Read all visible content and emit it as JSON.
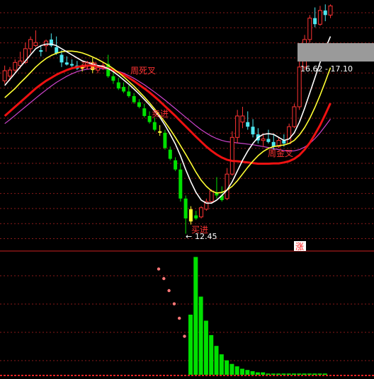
{
  "chart_data": {
    "type": "candlestick",
    "price_panel": {
      "annotations": {
        "buy_1": "买进",
        "weekly_death_cross": "周死叉",
        "sell": "卖进",
        "weekly_golden_cross": "周金叉",
        "buy_2": "买进",
        "low_price": "12.45",
        "range_label": "16.62 - 17.10",
        "rise_tag": "涨"
      },
      "candles": [
        {
          "o": 17.78,
          "h": 17.95,
          "l": 17.35,
          "c": 17.45,
          "color": "red"
        },
        {
          "o": 17.6,
          "h": 17.9,
          "l": 17.45,
          "c": 17.8,
          "color": "red"
        },
        {
          "o": 17.8,
          "h": 18.15,
          "l": 17.7,
          "c": 18.05,
          "color": "red"
        },
        {
          "o": 18.1,
          "h": 18.4,
          "l": 17.85,
          "c": 17.95,
          "color": "red"
        },
        {
          "o": 18.05,
          "h": 18.7,
          "l": 18.0,
          "c": 18.5,
          "color": "red"
        },
        {
          "o": 18.5,
          "h": 18.9,
          "l": 18.35,
          "c": 18.8,
          "color": "red"
        },
        {
          "o": 18.6,
          "h": 19.1,
          "l": 18.55,
          "c": 18.7,
          "color": "red"
        },
        {
          "o": 18.4,
          "h": 18.6,
          "l": 18.25,
          "c": 18.45,
          "color": "cyan"
        },
        {
          "o": 18.6,
          "h": 18.8,
          "l": 18.4,
          "c": 18.75,
          "color": "red"
        },
        {
          "o": 18.8,
          "h": 19.0,
          "l": 18.55,
          "c": 18.6,
          "color": "cyan"
        },
        {
          "o": 18.55,
          "h": 18.9,
          "l": 18.3,
          "c": 18.35,
          "color": "cyan"
        },
        {
          "o": 18.3,
          "h": 18.45,
          "l": 17.9,
          "c": 18.05,
          "color": "cyan"
        },
        {
          "o": 18.05,
          "h": 18.25,
          "l": 17.95,
          "c": 17.98,
          "color": "cyan"
        },
        {
          "o": 18.0,
          "h": 18.15,
          "l": 17.9,
          "c": 17.95,
          "color": "cyan"
        },
        {
          "o": 17.95,
          "h": 18.1,
          "l": 17.8,
          "c": 17.85,
          "color": "cyan"
        },
        {
          "o": 17.85,
          "h": 18.0,
          "l": 17.75,
          "c": 17.9,
          "color": "yellow"
        },
        {
          "o": 17.95,
          "h": 18.1,
          "l": 17.85,
          "c": 18.05,
          "color": "red"
        },
        {
          "o": 18.05,
          "h": 18.2,
          "l": 17.7,
          "c": 17.8,
          "color": "yellow"
        },
        {
          "o": 17.8,
          "h": 17.95,
          "l": 17.7,
          "c": 17.88,
          "color": "red"
        },
        {
          "o": 17.9,
          "h": 18.05,
          "l": 17.8,
          "c": 17.95,
          "color": "red"
        },
        {
          "o": 18.0,
          "h": 18.3,
          "l": 17.55,
          "c": 17.6,
          "color": "green"
        },
        {
          "o": 17.6,
          "h": 17.8,
          "l": 17.35,
          "c": 17.45,
          "color": "green"
        },
        {
          "o": 17.4,
          "h": 17.55,
          "l": 17.15,
          "c": 17.2,
          "color": "green"
        },
        {
          "o": 17.25,
          "h": 17.4,
          "l": 17.05,
          "c": 17.1,
          "color": "green"
        },
        {
          "o": 17.1,
          "h": 17.3,
          "l": 16.9,
          "c": 16.95,
          "color": "green"
        },
        {
          "o": 16.95,
          "h": 17.05,
          "l": 16.7,
          "c": 16.75,
          "color": "green"
        },
        {
          "o": 16.75,
          "h": 16.85,
          "l": 16.55,
          "c": 16.6,
          "color": "green"
        },
        {
          "o": 16.55,
          "h": 16.7,
          "l": 16.25,
          "c": 16.3,
          "color": "green"
        },
        {
          "o": 16.3,
          "h": 16.45,
          "l": 16.05,
          "c": 16.1,
          "color": "green"
        },
        {
          "o": 16.1,
          "h": 16.25,
          "l": 15.8,
          "c": 15.85,
          "color": "green"
        },
        {
          "o": 15.8,
          "h": 16.0,
          "l": 15.65,
          "c": 15.75,
          "color": "yellow"
        },
        {
          "o": 15.75,
          "h": 15.85,
          "l": 15.2,
          "c": 15.25,
          "color": "green"
        },
        {
          "o": 15.2,
          "h": 15.3,
          "l": 14.85,
          "c": 14.9,
          "color": "green"
        },
        {
          "o": 14.85,
          "h": 14.95,
          "l": 14.5,
          "c": 14.55,
          "color": "green"
        },
        {
          "o": 14.55,
          "h": 14.75,
          "l": 13.5,
          "c": 13.6,
          "color": "green"
        },
        {
          "o": 13.6,
          "h": 13.7,
          "l": 12.45,
          "c": 12.95,
          "color": "green"
        },
        {
          "o": 12.85,
          "h": 13.35,
          "l": 12.75,
          "c": 13.25,
          "color": "yellow"
        },
        {
          "o": 13.05,
          "h": 13.2,
          "l": 12.9,
          "c": 12.95,
          "color": "green"
        },
        {
          "o": 13.0,
          "h": 13.35,
          "l": 12.95,
          "c": 13.3,
          "color": "red"
        },
        {
          "o": 13.25,
          "h": 13.6,
          "l": 13.2,
          "c": 13.5,
          "color": "red"
        },
        {
          "o": 13.5,
          "h": 13.9,
          "l": 13.45,
          "c": 13.85,
          "color": "red"
        },
        {
          "o": 13.8,
          "h": 14.3,
          "l": 13.6,
          "c": 13.7,
          "color": "green"
        },
        {
          "o": 13.7,
          "h": 14.0,
          "l": 13.5,
          "c": 13.55,
          "color": "green"
        },
        {
          "o": 13.6,
          "h": 14.6,
          "l": 13.55,
          "c": 14.4,
          "color": "red"
        },
        {
          "o": 14.4,
          "h": 15.8,
          "l": 14.35,
          "c": 15.6,
          "color": "red"
        },
        {
          "o": 15.6,
          "h": 16.5,
          "l": 15.4,
          "c": 16.3,
          "color": "red"
        },
        {
          "o": 16.3,
          "h": 16.6,
          "l": 15.9,
          "c": 16.1,
          "color": "red"
        },
        {
          "o": 16.1,
          "h": 16.45,
          "l": 15.85,
          "c": 15.95,
          "color": "cyan"
        },
        {
          "o": 15.95,
          "h": 16.2,
          "l": 15.6,
          "c": 15.7,
          "color": "cyan"
        },
        {
          "o": 15.7,
          "h": 15.9,
          "l": 15.4,
          "c": 15.5,
          "color": "cyan"
        },
        {
          "o": 15.5,
          "h": 15.7,
          "l": 15.3,
          "c": 15.55,
          "color": "red"
        },
        {
          "o": 15.55,
          "h": 15.85,
          "l": 15.4,
          "c": 15.45,
          "color": "cyan"
        },
        {
          "o": 15.45,
          "h": 15.7,
          "l": 15.2,
          "c": 15.3,
          "color": "cyan"
        },
        {
          "o": 15.3,
          "h": 15.6,
          "l": 15.25,
          "c": 15.5,
          "color": "red"
        },
        {
          "o": 15.5,
          "h": 15.7,
          "l": 15.3,
          "c": 15.4,
          "color": "cyan"
        },
        {
          "o": 15.4,
          "h": 16.05,
          "l": 15.4,
          "c": 15.95,
          "color": "red"
        },
        {
          "o": 15.95,
          "h": 16.7,
          "l": 15.9,
          "c": 16.6,
          "color": "red"
        },
        {
          "o": 16.6,
          "h": 18.1,
          "l": 16.5,
          "c": 17.9,
          "color": "red"
        },
        {
          "o": 17.9,
          "h": 18.95,
          "l": 17.8,
          "c": 18.8,
          "color": "red"
        },
        {
          "o": 18.8,
          "h": 19.6,
          "l": 18.7,
          "c": 19.5,
          "color": "red"
        },
        {
          "o": 19.5,
          "h": 19.85,
          "l": 19.2,
          "c": 19.3,
          "color": "cyan"
        },
        {
          "o": 19.3,
          "h": 19.9,
          "l": 19.25,
          "c": 19.75,
          "color": "red"
        },
        {
          "o": 19.75,
          "h": 19.95,
          "l": 19.4,
          "c": 19.6,
          "color": "cyan"
        },
        {
          "o": 19.6,
          "h": 19.95,
          "l": 19.5,
          "c": 19.9,
          "color": "red"
        }
      ],
      "ma_short": [
        17.3,
        17.5,
        17.7,
        17.9,
        18.1,
        18.3,
        18.5,
        18.6,
        18.65,
        18.65,
        18.6,
        18.5,
        18.4,
        18.3,
        18.2,
        18.1,
        18.05,
        18.0,
        17.95,
        17.92,
        17.85,
        17.75,
        17.62,
        17.48,
        17.34,
        17.18,
        17.02,
        16.84,
        16.66,
        16.46,
        16.26,
        16.0,
        15.7,
        15.38,
        15.0,
        14.55,
        14.15,
        13.8,
        13.55,
        13.45,
        13.45,
        13.55,
        13.7,
        13.88,
        14.15,
        14.5,
        14.85,
        15.15,
        15.4,
        15.6,
        15.7,
        15.72,
        15.7,
        15.6,
        15.5,
        15.55,
        15.75,
        16.1,
        16.55,
        17.05,
        17.55,
        18.05,
        18.5,
        18.9
      ],
      "ma_mid": [
        16.9,
        17.05,
        17.2,
        17.38,
        17.55,
        17.72,
        17.9,
        18.05,
        18.18,
        18.28,
        18.35,
        18.4,
        18.42,
        18.42,
        18.4,
        18.36,
        18.3,
        18.23,
        18.15,
        18.06,
        17.96,
        17.85,
        17.72,
        17.58,
        17.43,
        17.27,
        17.1,
        16.92,
        16.73,
        16.53,
        16.32,
        16.1,
        15.86,
        15.6,
        15.33,
        15.05,
        14.76,
        14.46,
        14.2,
        14.0,
        13.85,
        13.78,
        13.8,
        13.88,
        14.0,
        14.18,
        14.4,
        14.62,
        14.82,
        15.0,
        15.14,
        15.24,
        15.3,
        15.33,
        15.35,
        15.4,
        15.5,
        15.68,
        15.92,
        16.22,
        16.58,
        16.98,
        17.42,
        17.88
      ],
      "ma_long": [
        16.3,
        16.45,
        16.6,
        16.75,
        16.9,
        17.05,
        17.2,
        17.33,
        17.45,
        17.55,
        17.65,
        17.73,
        17.8,
        17.86,
        17.9,
        17.93,
        17.95,
        17.95,
        17.93,
        17.9,
        17.86,
        17.8,
        17.73,
        17.65,
        17.55,
        17.44,
        17.32,
        17.2,
        17.07,
        16.93,
        16.78,
        16.62,
        16.46,
        16.3,
        16.13,
        15.96,
        15.79,
        15.62,
        15.46,
        15.3,
        15.16,
        15.04,
        14.94,
        14.87,
        14.83,
        14.82,
        14.8,
        14.78,
        14.76,
        14.74,
        14.74,
        14.74,
        14.75,
        14.75,
        14.78,
        14.82,
        14.9,
        15.02,
        15.2,
        15.42,
        15.7,
        16.0,
        16.35,
        16.72
      ],
      "ma_magenta": [
        16.05,
        16.18,
        16.32,
        16.46,
        16.6,
        16.74,
        16.88,
        17.02,
        17.15,
        17.28,
        17.4,
        17.5,
        17.6,
        17.68,
        17.75,
        17.8,
        17.83,
        17.85,
        17.86,
        17.85,
        17.83,
        17.8,
        17.76,
        17.7,
        17.62,
        17.53,
        17.43,
        17.32,
        17.2,
        17.08,
        16.95,
        16.82,
        16.68,
        16.54,
        16.4,
        16.26,
        16.12,
        15.98,
        15.85,
        15.74,
        15.64,
        15.56,
        15.5,
        15.46,
        15.44,
        15.42,
        15.4,
        15.38,
        15.36,
        15.33,
        15.3,
        15.27,
        15.23,
        15.2,
        15.17,
        15.15,
        15.16,
        15.2,
        15.28,
        15.4,
        15.56,
        15.75,
        15.97,
        16.2
      ]
    },
    "indicator_panel": {
      "type": "bar",
      "dots": [
        0.88,
        0.8,
        0.7,
        0.59,
        0.47,
        0.32
      ],
      "bars": [
        0.5,
        0.98,
        0.65,
        0.45,
        0.33,
        0.24,
        0.17,
        0.12,
        0.09,
        0.07,
        0.05,
        0.04,
        0.03,
        0.02,
        0.02,
        0.01,
        0.01,
        0.01,
        0.01,
        0.01,
        0.01,
        0.01,
        0.01,
        0.01,
        0.01,
        0.01,
        0.01
      ]
    },
    "colors": {
      "background": "#000000",
      "up": "#ff3333",
      "down": "#00e000",
      "cyan": "#4ee8f0",
      "yellow_candle": "#ffff33",
      "ma_short": "#ffffff",
      "ma_mid": "#ffff33",
      "ma_long": "#ee1111",
      "ma_magenta": "#cc44cc",
      "grid": "#8a1a1a",
      "annotation": "#ff3333",
      "label": "#ffffff"
    },
    "ylim": [
      12.0,
      20.0
    ]
  }
}
